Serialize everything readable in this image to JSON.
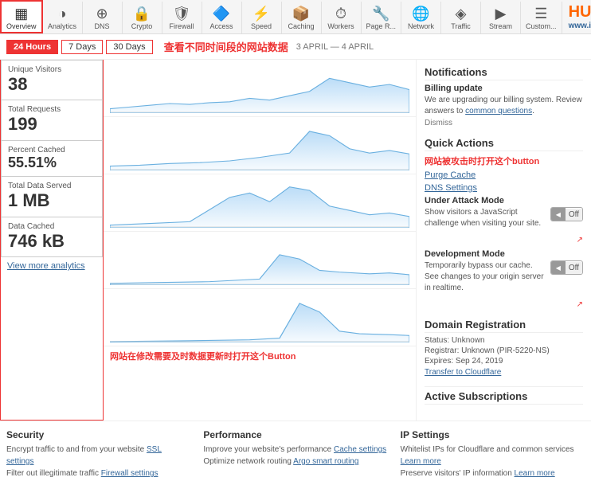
{
  "nav": {
    "items": [
      {
        "id": "overview",
        "label": "Overview",
        "icon": "▦",
        "active": true
      },
      {
        "id": "analytics",
        "label": "Analytics",
        "icon": "◑"
      },
      {
        "id": "dns",
        "label": "DNS",
        "icon": "⊕"
      },
      {
        "id": "crypto",
        "label": "Crypto",
        "icon": "🔒"
      },
      {
        "id": "firewall",
        "label": "Firewall",
        "icon": "🛡"
      },
      {
        "id": "access",
        "label": "Access",
        "icon": "🔷"
      },
      {
        "id": "speed",
        "label": "Speed",
        "icon": "⚡"
      },
      {
        "id": "caching",
        "label": "Caching",
        "icon": "📦"
      },
      {
        "id": "workers",
        "label": "Workers",
        "icon": "⏱"
      },
      {
        "id": "page-rules",
        "label": "Page R...",
        "icon": "🔧"
      },
      {
        "id": "network",
        "label": "Network",
        "icon": "🌐"
      },
      {
        "id": "traffic",
        "label": "Traffic",
        "icon": "◈"
      },
      {
        "id": "stream",
        "label": "Stream",
        "icon": "▶"
      },
      {
        "id": "custom",
        "label": "Custom...",
        "icon": "☰"
      }
    ]
  },
  "logo": {
    "text": "HUNK",
    "url": "www.imhunk.com"
  },
  "time_filter": {
    "buttons": [
      "24 Hours",
      "7 Days",
      "30 Days"
    ],
    "active": "24 Hours",
    "note": "查看不同时间段的网站数据",
    "date_range": "3 APRIL — 4 APRIL"
  },
  "stats": [
    {
      "label": "Unique Visitors",
      "value": "38"
    },
    {
      "label": "Total Requests",
      "value": "199"
    },
    {
      "label": "Percent Cached",
      "value": "55.51%"
    },
    {
      "label": "Total Data Served",
      "value": "1 MB"
    },
    {
      "label": "Data Cached",
      "value": "746 kB"
    }
  ],
  "view_more": "View more analytics",
  "notifications": {
    "title": "Notifications",
    "billing": {
      "title": "Billing update",
      "text": "We are upgrading our billing system. Review answers to",
      "link_text": "common questions",
      "dismiss": "Dismiss"
    }
  },
  "quick_actions": {
    "title": "Quick Actions",
    "purge_cache": "Purge Cache",
    "dns_settings": "DNS Settings",
    "attack_note": "网站被攻击时打开这个button",
    "under_attack": {
      "label": "Under Attack Mode",
      "desc": "Show visitors a JavaScript challenge when visiting your site.",
      "toggle": "Off"
    },
    "dev_mode": {
      "label": "Development Mode",
      "desc": "Temporarily bypass our cache. See changes to your origin server in realtime.",
      "toggle": "Off"
    },
    "dev_note": "网站在修改需要及时数据更新时打开这个Button"
  },
  "domain_registration": {
    "title": "Domain Registration",
    "status": "Status: Unknown",
    "registrar": "Registrar: Unknown (PIR-5220-NS)",
    "expires": "Expires: Sep 24, 2019",
    "transfer": "Transfer to Cloudflare"
  },
  "active_subscriptions": {
    "title": "Active Subscriptions"
  },
  "bottom": {
    "security": {
      "title": "Security",
      "text1": "Encrypt traffic to and from your website",
      "link1": "SSL settings",
      "text2": "Filter out illegitimate traffic",
      "link2": "Firewall settings"
    },
    "performance": {
      "title": "Performance",
      "text1": "Improve your website's performance",
      "link1": "Cache settings",
      "text2": "Optimize network routing",
      "link2": "Argo smart routing"
    },
    "ip_settings": {
      "title": "IP Settings",
      "text1": "Whitelist IPs for Cloudflare and common services",
      "link1": "Learn more",
      "text2": "Preserve visitors' IP information",
      "link2": "Learn more"
    }
  }
}
